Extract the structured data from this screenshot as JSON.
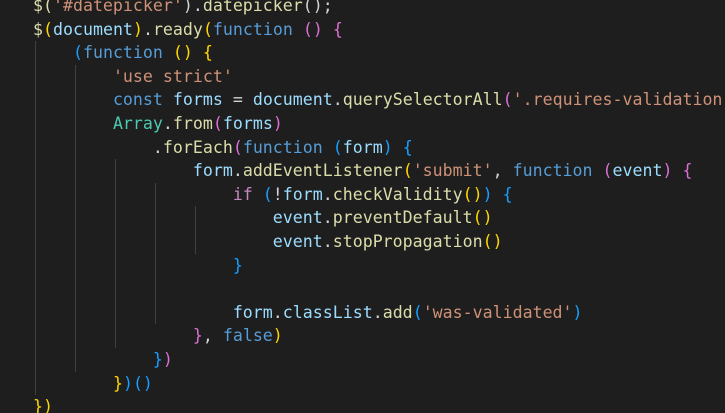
{
  "editor": {
    "background": "#1e1e1e",
    "colors": {
      "fn": "#dcdcaa",
      "var": "#9cdcfe",
      "kw": "#569cd6",
      "str": "#ce9178",
      "cls": "#4ec9b0",
      "plain": "#d4d4d4",
      "ctrl": "#c586c0",
      "b1": "#ffd700",
      "b2": "#da70d6",
      "b3": "#179fff"
    },
    "lines": [
      [
        {
          "t": "$(",
          "c": "fn"
        },
        {
          "t": "'#datepicker'",
          "c": "str"
        },
        {
          "t": ").",
          "c": "plain"
        },
        {
          "t": "datepicker",
          "c": "fn"
        },
        {
          "t": "();",
          "c": "plain"
        }
      ],
      [
        {
          "t": "$",
          "c": "fn"
        },
        {
          "t": "(",
          "c": "b1"
        },
        {
          "t": "document",
          "c": "var"
        },
        {
          "t": ")",
          "c": "b1"
        },
        {
          "t": ".",
          "c": "plain"
        },
        {
          "t": "ready",
          "c": "fn"
        },
        {
          "t": "(",
          "c": "b1"
        },
        {
          "t": "function",
          "c": "kw"
        },
        {
          "t": " ",
          "c": "plain"
        },
        {
          "t": "()",
          "c": "b2"
        },
        {
          "t": " ",
          "c": "plain"
        },
        {
          "t": "{",
          "c": "b2"
        }
      ],
      [
        {
          "t": "    ",
          "c": "plain"
        },
        {
          "t": "(",
          "c": "b3"
        },
        {
          "t": "function",
          "c": "kw"
        },
        {
          "t": " ",
          "c": "plain"
        },
        {
          "t": "()",
          "c": "b1"
        },
        {
          "t": " ",
          "c": "plain"
        },
        {
          "t": "{",
          "c": "b1"
        }
      ],
      [
        {
          "t": "        ",
          "c": "plain"
        },
        {
          "t": "'use strict'",
          "c": "str"
        }
      ],
      [
        {
          "t": "        ",
          "c": "plain"
        },
        {
          "t": "const",
          "c": "kw"
        },
        {
          "t": " ",
          "c": "plain"
        },
        {
          "t": "forms",
          "c": "var"
        },
        {
          "t": " = ",
          "c": "plain"
        },
        {
          "t": "document",
          "c": "var"
        },
        {
          "t": ".",
          "c": "plain"
        },
        {
          "t": "querySelectorAll",
          "c": "fn"
        },
        {
          "t": "(",
          "c": "b2"
        },
        {
          "t": "'.requires-validation'",
          "c": "str"
        },
        {
          "t": ")",
          "c": "b2"
        }
      ],
      [
        {
          "t": "        ",
          "c": "plain"
        },
        {
          "t": "Array",
          "c": "cls"
        },
        {
          "t": ".",
          "c": "plain"
        },
        {
          "t": "from",
          "c": "fn"
        },
        {
          "t": "(",
          "c": "b2"
        },
        {
          "t": "forms",
          "c": "var"
        },
        {
          "t": ")",
          "c": "b2"
        }
      ],
      [
        {
          "t": "            ",
          "c": "plain"
        },
        {
          "t": ".",
          "c": "plain"
        },
        {
          "t": "forEach",
          "c": "fn"
        },
        {
          "t": "(",
          "c": "b2"
        },
        {
          "t": "function",
          "c": "kw"
        },
        {
          "t": " ",
          "c": "plain"
        },
        {
          "t": "(",
          "c": "b3"
        },
        {
          "t": "form",
          "c": "var"
        },
        {
          "t": ")",
          "c": "b3"
        },
        {
          "t": " ",
          "c": "plain"
        },
        {
          "t": "{",
          "c": "b3"
        }
      ],
      [
        {
          "t": "                ",
          "c": "plain"
        },
        {
          "t": "form",
          "c": "var"
        },
        {
          "t": ".",
          "c": "plain"
        },
        {
          "t": "addEventListener",
          "c": "fn"
        },
        {
          "t": "(",
          "c": "b1"
        },
        {
          "t": "'submit'",
          "c": "str"
        },
        {
          "t": ", ",
          "c": "plain"
        },
        {
          "t": "function",
          "c": "kw"
        },
        {
          "t": " ",
          "c": "plain"
        },
        {
          "t": "(",
          "c": "b2"
        },
        {
          "t": "event",
          "c": "var"
        },
        {
          "t": ")",
          "c": "b2"
        },
        {
          "t": " ",
          "c": "plain"
        },
        {
          "t": "{",
          "c": "b2"
        }
      ],
      [
        {
          "t": "                    ",
          "c": "plain"
        },
        {
          "t": "if",
          "c": "ctrl"
        },
        {
          "t": " ",
          "c": "plain"
        },
        {
          "t": "(",
          "c": "b3"
        },
        {
          "t": "!",
          "c": "plain"
        },
        {
          "t": "form",
          "c": "var"
        },
        {
          "t": ".",
          "c": "plain"
        },
        {
          "t": "checkValidity",
          "c": "fn"
        },
        {
          "t": "()",
          "c": "b1"
        },
        {
          "t": ")",
          "c": "b3"
        },
        {
          "t": " ",
          "c": "plain"
        },
        {
          "t": "{",
          "c": "b3"
        }
      ],
      [
        {
          "t": "                        ",
          "c": "plain"
        },
        {
          "t": "event",
          "c": "var"
        },
        {
          "t": ".",
          "c": "plain"
        },
        {
          "t": "preventDefault",
          "c": "fn"
        },
        {
          "t": "()",
          "c": "b1"
        }
      ],
      [
        {
          "t": "                        ",
          "c": "plain"
        },
        {
          "t": "event",
          "c": "var"
        },
        {
          "t": ".",
          "c": "plain"
        },
        {
          "t": "stopPropagation",
          "c": "fn"
        },
        {
          "t": "()",
          "c": "b1"
        }
      ],
      [
        {
          "t": "                    ",
          "c": "plain"
        },
        {
          "t": "}",
          "c": "b3"
        }
      ],
      [],
      [
        {
          "t": "                    ",
          "c": "plain"
        },
        {
          "t": "form",
          "c": "var"
        },
        {
          "t": ".",
          "c": "plain"
        },
        {
          "t": "classList",
          "c": "var"
        },
        {
          "t": ".",
          "c": "plain"
        },
        {
          "t": "add",
          "c": "fn"
        },
        {
          "t": "(",
          "c": "b3"
        },
        {
          "t": "'was-validated'",
          "c": "str"
        },
        {
          "t": ")",
          "c": "b3"
        }
      ],
      [
        {
          "t": "                ",
          "c": "plain"
        },
        {
          "t": "}",
          "c": "b2"
        },
        {
          "t": ", ",
          "c": "plain"
        },
        {
          "t": "false",
          "c": "kw"
        },
        {
          "t": ")",
          "c": "b1"
        }
      ],
      [
        {
          "t": "            ",
          "c": "plain"
        },
        {
          "t": "}",
          "c": "b3"
        },
        {
          "t": ")",
          "c": "b2"
        }
      ],
      [
        {
          "t": "        ",
          "c": "plain"
        },
        {
          "t": "}",
          "c": "b1"
        },
        {
          "t": ")",
          "c": "b3"
        },
        {
          "t": "()",
          "c": "b3"
        }
      ],
      [
        {
          "t": "})",
          "c": "b1"
        }
      ]
    ]
  }
}
